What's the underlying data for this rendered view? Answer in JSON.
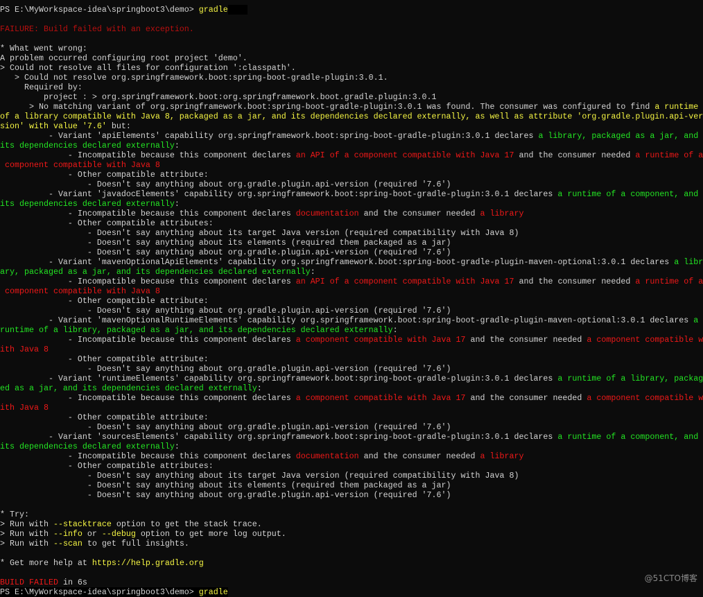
{
  "colors": {
    "background": "#0c0c0c",
    "w": "#d4d4d4",
    "y": "#f5f543",
    "g": "#23e523",
    "r": "#f01818",
    "dr": "#b80f0f"
  },
  "watermark": "@51CTO博客",
  "rows": [
    [
      {
        "t": "PS E:\\MyWorkspace-idea\\springboot3\\demo> ",
        "c": "w"
      },
      {
        "t": "gradle",
        "c": "y"
      }
    ],
    [],
    [
      {
        "t": "FAILURE: Build failed with an exception.",
        "c": "dr"
      }
    ],
    [],
    [
      {
        "t": "* What went wrong:",
        "c": "w"
      }
    ],
    [
      {
        "t": "A problem occurred configuring root project 'demo'.",
        "c": "w"
      }
    ],
    [
      {
        "t": "> Could not resolve all files for configuration ':classpath'.",
        "c": "w"
      }
    ],
    [
      {
        "t": "   > Could not resolve org.springframework.boot:spring-boot-gradle-plugin:3.0.1.",
        "c": "w"
      }
    ],
    [
      {
        "t": "     Required by:",
        "c": "w"
      }
    ],
    [
      {
        "t": "         project : > org.springframework.boot:org.springframework.boot.gradle.plugin:3.0.1",
        "c": "w"
      }
    ],
    [
      {
        "t": "      > No matching variant of org.springframework.boot:spring-boot-gradle-plugin:3.0.1 was found. The consumer was configured to find ",
        "c": "w"
      },
      {
        "t": "a runtime",
        "c": "y"
      }
    ],
    [
      {
        "t": "of a library compatible with Java 8, packaged as a jar, and its dependencies declared externally, as well as attribute 'org.gradle.plugin.api-ver",
        "c": "y"
      }
    ],
    [
      {
        "t": "sion' with value '7.6'",
        "c": "y"
      },
      {
        "t": " but:",
        "c": "w"
      }
    ],
    [
      {
        "t": "          - Variant 'apiElements' capability org.springframework.boot:spring-boot-gradle-plugin:3.0.1 declares ",
        "c": "w"
      },
      {
        "t": "a library, packaged as a jar, and",
        "c": "g"
      }
    ],
    [
      {
        "t": "its dependencies declared externally",
        "c": "g"
      },
      {
        "t": ":",
        "c": "w"
      }
    ],
    [
      {
        "t": "              - Incompatible because this component declares ",
        "c": "w"
      },
      {
        "t": "an API of a component compatible with Java 17",
        "c": "r"
      },
      {
        "t": " and the consumer needed ",
        "c": "w"
      },
      {
        "t": "a runtime of a",
        "c": "r"
      }
    ],
    [
      {
        "t": " component compatible with Java 8",
        "c": "r"
      }
    ],
    [
      {
        "t": "              - Other compatible attribute:",
        "c": "w"
      }
    ],
    [
      {
        "t": "                  - Doesn't say anything about org.gradle.plugin.api-version (required '7.6')",
        "c": "w"
      }
    ],
    [
      {
        "t": "          - Variant 'javadocElements' capability org.springframework.boot:spring-boot-gradle-plugin:3.0.1 declares ",
        "c": "w"
      },
      {
        "t": "a runtime of a component, and",
        "c": "g"
      }
    ],
    [
      {
        "t": "its dependencies declared externally",
        "c": "g"
      },
      {
        "t": ":",
        "c": "w"
      }
    ],
    [
      {
        "t": "              - Incompatible because this component declares ",
        "c": "w"
      },
      {
        "t": "documentation",
        "c": "r"
      },
      {
        "t": " and the consumer needed ",
        "c": "w"
      },
      {
        "t": "a library",
        "c": "r"
      }
    ],
    [
      {
        "t": "              - Other compatible attributes:",
        "c": "w"
      }
    ],
    [
      {
        "t": "                  - Doesn't say anything about its target Java version (required compatibility with Java 8)",
        "c": "w"
      }
    ],
    [
      {
        "t": "                  - Doesn't say anything about its elements (required them packaged as a jar)",
        "c": "w"
      }
    ],
    [
      {
        "t": "                  - Doesn't say anything about org.gradle.plugin.api-version (required '7.6')",
        "c": "w"
      }
    ],
    [
      {
        "t": "          - Variant 'mavenOptionalApiElements' capability org.springframework.boot:spring-boot-gradle-plugin-maven-optional:3.0.1 declares ",
        "c": "w"
      },
      {
        "t": "a libr",
        "c": "g"
      }
    ],
    [
      {
        "t": "ary, packaged as a jar, and its dependencies declared externally",
        "c": "g"
      },
      {
        "t": ":",
        "c": "w"
      }
    ],
    [
      {
        "t": "              - Incompatible because this component declares ",
        "c": "w"
      },
      {
        "t": "an API of a component compatible with Java 17",
        "c": "r"
      },
      {
        "t": " and the consumer needed ",
        "c": "w"
      },
      {
        "t": "a runtime of a",
        "c": "r"
      }
    ],
    [
      {
        "t": " component compatible with Java 8",
        "c": "r"
      }
    ],
    [
      {
        "t": "              - Other compatible attribute:",
        "c": "w"
      }
    ],
    [
      {
        "t": "                  - Doesn't say anything about org.gradle.plugin.api-version (required '7.6')",
        "c": "w"
      }
    ],
    [
      {
        "t": "          - Variant 'mavenOptionalRuntimeElements' capability org.springframework.boot:spring-boot-gradle-plugin-maven-optional:3.0.1 declares ",
        "c": "w"
      },
      {
        "t": "a",
        "c": "g"
      }
    ],
    [
      {
        "t": "runtime of a library, packaged as a jar, and its dependencies declared externally",
        "c": "g"
      },
      {
        "t": ":",
        "c": "w"
      }
    ],
    [
      {
        "t": "              - Incompatible because this component declares ",
        "c": "w"
      },
      {
        "t": "a component compatible with Java 17",
        "c": "r"
      },
      {
        "t": " and the consumer needed ",
        "c": "w"
      },
      {
        "t": "a component compatible w",
        "c": "r"
      }
    ],
    [
      {
        "t": "ith Java 8",
        "c": "r"
      }
    ],
    [
      {
        "t": "              - Other compatible attribute:",
        "c": "w"
      }
    ],
    [
      {
        "t": "                  - Doesn't say anything about org.gradle.plugin.api-version (required '7.6')",
        "c": "w"
      }
    ],
    [
      {
        "t": "          - Variant 'runtimeElements' capability org.springframework.boot:spring-boot-gradle-plugin:3.0.1 declares ",
        "c": "w"
      },
      {
        "t": "a runtime of a library, packag",
        "c": "g"
      }
    ],
    [
      {
        "t": "ed as a jar, and its dependencies declared externally",
        "c": "g"
      },
      {
        "t": ":",
        "c": "w"
      }
    ],
    [
      {
        "t": "              - Incompatible because this component declares ",
        "c": "w"
      },
      {
        "t": "a component compatible with Java 17",
        "c": "r"
      },
      {
        "t": " and the consumer needed ",
        "c": "w"
      },
      {
        "t": "a component compatible w",
        "c": "r"
      }
    ],
    [
      {
        "t": "ith Java 8",
        "c": "r"
      }
    ],
    [
      {
        "t": "              - Other compatible attribute:",
        "c": "w"
      }
    ],
    [
      {
        "t": "                  - Doesn't say anything about org.gradle.plugin.api-version (required '7.6')",
        "c": "w"
      }
    ],
    [
      {
        "t": "          - Variant 'sourcesElements' capability org.springframework.boot:spring-boot-gradle-plugin:3.0.1 declares ",
        "c": "w"
      },
      {
        "t": "a runtime of a component, and",
        "c": "g"
      }
    ],
    [
      {
        "t": "its dependencies declared externally",
        "c": "g"
      },
      {
        "t": ":",
        "c": "w"
      }
    ],
    [
      {
        "t": "              - Incompatible because this component declares ",
        "c": "w"
      },
      {
        "t": "documentation",
        "c": "r"
      },
      {
        "t": " and the consumer needed ",
        "c": "w"
      },
      {
        "t": "a library",
        "c": "r"
      }
    ],
    [
      {
        "t": "              - Other compatible attributes:",
        "c": "w"
      }
    ],
    [
      {
        "t": "                  - Doesn't say anything about its target Java version (required compatibility with Java 8)",
        "c": "w"
      }
    ],
    [
      {
        "t": "                  - Doesn't say anything about its elements (required them packaged as a jar)",
        "c": "w"
      }
    ],
    [
      {
        "t": "                  - Doesn't say anything about org.gradle.plugin.api-version (required '7.6')",
        "c": "w"
      }
    ],
    [],
    [
      {
        "t": "* Try:",
        "c": "w"
      }
    ],
    [
      {
        "t": "> Run with ",
        "c": "w"
      },
      {
        "t": "--stacktrace",
        "c": "y"
      },
      {
        "t": " option to get the stack trace.",
        "c": "w"
      }
    ],
    [
      {
        "t": "> Run with ",
        "c": "w"
      },
      {
        "t": "--info",
        "c": "y"
      },
      {
        "t": " or ",
        "c": "w"
      },
      {
        "t": "--debug",
        "c": "y"
      },
      {
        "t": " option to get more log output.",
        "c": "w"
      }
    ],
    [
      {
        "t": "> Run with ",
        "c": "w"
      },
      {
        "t": "--scan",
        "c": "y"
      },
      {
        "t": " to get full insights.",
        "c": "w"
      }
    ],
    [],
    [
      {
        "t": "* Get more help at ",
        "c": "w"
      },
      {
        "t": "https://help.gradle.org",
        "c": "y"
      }
    ],
    [],
    [
      {
        "t": "BUILD FAILED",
        "c": "r"
      },
      {
        "t": " in 6s",
        "c": "w"
      }
    ],
    [
      {
        "t": "PS E:\\MyWorkspace-idea\\springboot3\\demo> ",
        "c": "w"
      },
      {
        "t": "gradle",
        "c": "y"
      }
    ]
  ]
}
